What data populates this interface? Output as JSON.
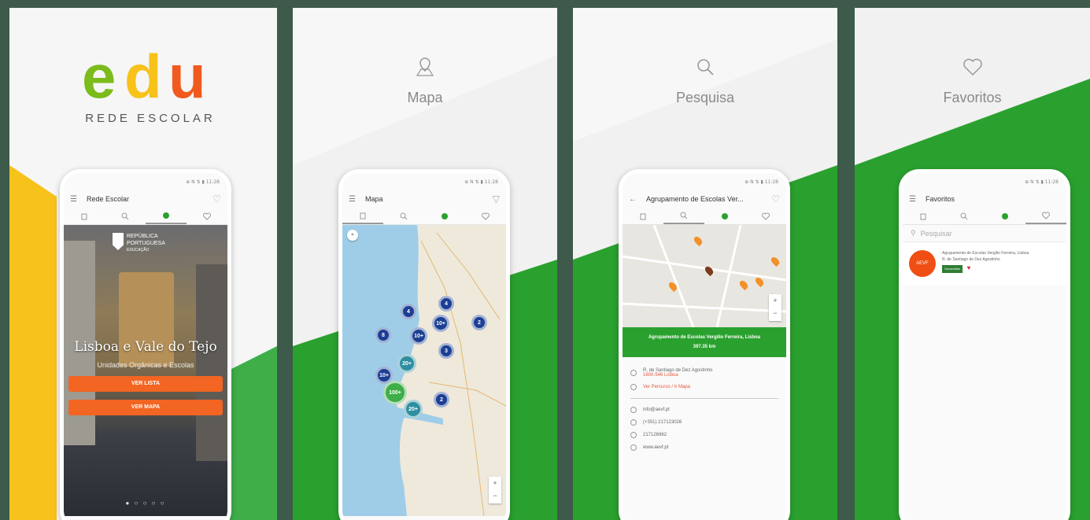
{
  "brand": {
    "logo_letters": [
      "e",
      "d",
      "u"
    ],
    "subtitle": "REDE ESCOLAR"
  },
  "colors": {
    "green": "#2aa12f",
    "orange": "#f26522",
    "yellow": "#f7c21a",
    "cluster_blue": "#1c3f94",
    "cluster_teal": "#2e8fa0",
    "cluster_green": "#3fae49"
  },
  "screens": [
    {
      "id": "home",
      "status_text": "⊕ N ⇅ ▮ 11:28",
      "appbar_title": "Rede Escolar",
      "appbar_right_icon": "heart-outline-icon",
      "tabs": [
        "building-icon",
        "search-icon",
        "edu-logo-icon",
        "heart-icon"
      ],
      "active_tab": 2,
      "gov_label_1": "REPÚBLICA",
      "gov_label_2": "PORTUGUESA",
      "gov_label_3": "EDUCAÇÃO",
      "region_title": "Lisboa e Vale do Tejo",
      "region_subtitle": "Unidades Orgânicas e Escolas",
      "btn_list": "VER LISTA",
      "btn_map": "VER MAPA"
    },
    {
      "id": "map",
      "caption": "Mapa",
      "caption_icon": "map-pin-icon",
      "status_text": "⊕ N ⇅ ▮ 11:28",
      "appbar_title": "Mapa",
      "appbar_right_icon": "filter-icon",
      "tabs": [
        "building-icon",
        "search-icon",
        "edu-logo-icon",
        "heart-icon"
      ],
      "clusters": [
        {
          "label": "4",
          "size": 20,
          "color": "blue"
        },
        {
          "label": "4",
          "size": 20,
          "color": "blue"
        },
        {
          "label": "10+",
          "size": 22,
          "color": "blue"
        },
        {
          "label": "10+",
          "size": 22,
          "color": "blue"
        },
        {
          "label": "8",
          "size": 20,
          "color": "blue"
        },
        {
          "label": "3",
          "size": 20,
          "color": "blue"
        },
        {
          "label": "2",
          "size": 20,
          "color": "blue"
        },
        {
          "label": "20+",
          "size": 24,
          "color": "teal"
        },
        {
          "label": "10+",
          "size": 22,
          "color": "blue"
        },
        {
          "label": "100+",
          "size": 30,
          "color": "green"
        },
        {
          "label": "20+",
          "size": 24,
          "color": "teal"
        },
        {
          "label": "2",
          "size": 20,
          "color": "blue"
        }
      ]
    },
    {
      "id": "search",
      "caption": "Pesquisa",
      "caption_icon": "search-icon",
      "status_text": "⊕ N ⇅ ▮ 11:28",
      "appbar_title": "Agrupamento de Escolas Ver...",
      "appbar_right_icon": "heart-outline-icon",
      "tabs": [
        "building-icon",
        "search-icon",
        "edu-logo-icon",
        "heart-icon"
      ],
      "detail_title": "Agrupamento de Escolas Vergílio Ferreira, Lisboa",
      "detail_distance": "397.35 km",
      "address": "R. de Santiago de Dez Agostinho",
      "postal": "1600-546 Lisboa",
      "directions": "Ver Percurso / Ir Mapa",
      "email": "info@aevf.pt",
      "phone": "(+351) 217123026",
      "fax": "217126962",
      "website": "www.aevf.pt"
    },
    {
      "id": "favorites",
      "caption": "Favoritos",
      "caption_icon": "heart-icon",
      "status_text": "⊕ N ⇅ ▮ 11:28",
      "appbar_title": "Favoritos",
      "tabs": [
        "building-icon",
        "search-icon",
        "edu-logo-icon",
        "heart-icon"
      ],
      "active_tab": 3,
      "search_placeholder": "Pesquisar",
      "fav_name": "Agrupamento de Escolas Vergílio Ferreira, Lisboa",
      "fav_addr": "R. de Santiago de Dez Agostinho",
      "fav_badge": "Secundário",
      "fav_avatar": "AEVF"
    }
  ]
}
